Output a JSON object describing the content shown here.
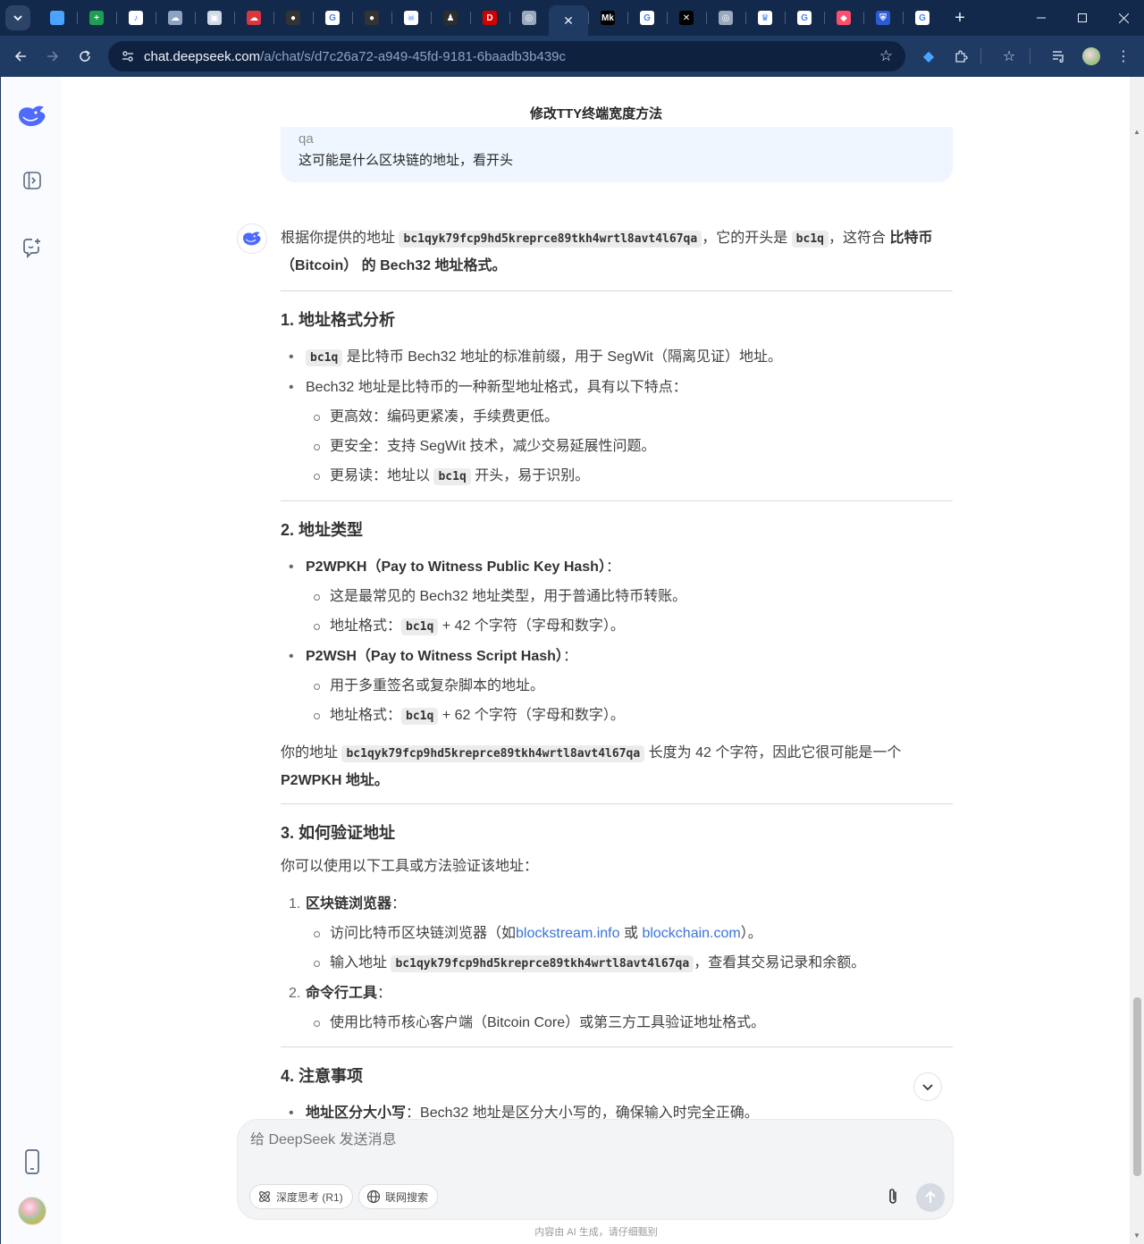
{
  "browser": {
    "tabs": [
      {
        "icon": "gem-icon",
        "color": "#4aa3ff",
        "text": ""
      },
      {
        "icon": "sheets-plus-icon",
        "color": "#1e9e52",
        "text": "+"
      },
      {
        "icon": "speaker-icon",
        "color": "#ffffff",
        "text": "♪"
      },
      {
        "icon": "cloud-icon",
        "color": "#8ea3c2",
        "text": "☁"
      },
      {
        "icon": "tv-icon",
        "color": "#cfd8e6",
        "text": "▣"
      },
      {
        "icon": "cloud-red-icon",
        "color": "#d9363e",
        "text": "☁"
      },
      {
        "icon": "github-icon",
        "color": "#333333",
        "text": "●"
      },
      {
        "icon": "google-icon",
        "color": "#ffffff",
        "text": "G"
      },
      {
        "icon": "github-icon",
        "color": "#333333",
        "text": "●"
      },
      {
        "icon": "skull-icon",
        "color": "#ffffff",
        "text": "☠"
      },
      {
        "icon": "figure-icon",
        "color": "#2d2d2d",
        "text": "♟"
      },
      {
        "icon": "d-letter-icon",
        "color": "#d40000",
        "text": "D"
      },
      {
        "icon": "chrome-icon",
        "color": "#9aa8bb",
        "text": "◎"
      },
      {
        "icon": "mk-icon",
        "color": "#000000",
        "text": "Mk"
      },
      {
        "icon": "google-icon",
        "color": "#ffffff",
        "text": "G"
      },
      {
        "icon": "x-grid-icon",
        "color": "#000000",
        "text": "✕"
      },
      {
        "icon": "chrome-icon",
        "color": "#9aa8bb",
        "text": "◎"
      },
      {
        "icon": "chef-hat-icon",
        "color": "#ffffff",
        "text": "♛"
      },
      {
        "icon": "google-icon",
        "color": "#ffffff",
        "text": "G"
      },
      {
        "icon": "cube-icon",
        "color": "#ff4d6d",
        "text": "◆"
      },
      {
        "icon": "shield-icon",
        "color": "#2d5bd3",
        "text": "⛨"
      },
      {
        "icon": "google-icon",
        "color": "#ffffff",
        "text": "G"
      }
    ],
    "active_tab_close": "✕",
    "new_tab": "+",
    "url_host": "chat.deepseek.com",
    "url_path": "/a/chat/s/d7c26a72-a949-45fd-9181-6baadb3b439c"
  },
  "chat": {
    "title": "修改TTY终端宽度方法",
    "user_prev_line": "qa",
    "user_message": "这可能是什么区块链的地址，看开头",
    "input_placeholder": "给 DeepSeek 发送消息",
    "deep_think_label": "深度思考 (R1)",
    "web_search_label": "联网搜索",
    "disclaimer": "内容由 AI 生成，请仔细甄别"
  },
  "answer": {
    "intro": {
      "p1": "根据你提供的地址",
      "addr": "bc1qyk79fcp9hd5kreprce89tkh4wrtl8avt4l67qa",
      "p2": "，它的开头是",
      "prefix": "bc1q",
      "p3": "，这符合",
      "bold": "比特币（Bitcoin） 的 Bech32 地址格式。"
    },
    "s1": {
      "title": "1. 地址格式分析",
      "b1_code": "bc1q",
      "b1_text": "是比特币 Bech32 地址的标准前缀，用于 SegWit（隔离见证）地址。",
      "b2_text": "Bech32 地址是比特币的一种新型地址格式，具有以下特点：",
      "sub1": "更高效：编码更紧凑，手续费更低。",
      "sub2": "更安全：支持 SegWit 技术，减少交易延展性问题。",
      "sub3_a": "更易读：地址以",
      "sub3_code": "bc1q",
      "sub3_b": "开头，易于识别。"
    },
    "s2": {
      "title": "2. 地址类型",
      "t1_bold": "P2WPKH（Pay to Witness Public Key Hash）",
      "t1_colon": "：",
      "t1_sub1": "这是最常见的 Bech32 地址类型，用于普通比特币转账。",
      "t1_sub2_a": "地址格式：",
      "t1_sub2_code": "bc1q",
      "t1_sub2_b": "+ 42 个字符（字母和数字）。",
      "t2_bold": "P2WSH（Pay to Witness Script Hash）",
      "t2_colon": "：",
      "t2_sub1": "用于多重签名或复杂脚本的地址。",
      "t2_sub2_a": "地址格式：",
      "t2_sub2_code": "bc1q",
      "t2_sub2_b": "+ 62 个字符（字母和数字）。",
      "concl_a": "你的地址",
      "concl_code": "bc1qyk79fcp9hd5kreprce89tkh4wrtl8avt4l67qa",
      "concl_b": "长度为 42 个字符，因此它很可能是一个",
      "concl_bold": "P2WPKH 地址。"
    },
    "s3": {
      "title": "3. 如何验证地址",
      "intro": "你可以使用以下工具或方法验证该地址：",
      "o1_num": "1.",
      "o1_bold": "区块链浏览器",
      "o1_colon": "：",
      "o1_sub1_a": "访问比特币区块链浏览器（如",
      "o1_link1": "blockstream.info",
      "o1_or": "或",
      "o1_link2": "blockchain.com",
      "o1_sub1_b": "）。",
      "o1_sub2_a": "输入地址",
      "o1_sub2_code": "bc1qyk79fcp9hd5kreprce89tkh4wrtl8avt4l67qa",
      "o1_sub2_b": "，查看其交易记录和余额。",
      "o2_num": "2.",
      "o2_bold": "命令行工具",
      "o2_colon": "：",
      "o2_sub1": "使用比特币核心客户端（Bitcoin Core）或第三方工具验证地址格式。"
    },
    "s4": {
      "title": "4. 注意事项",
      "b1_bold": "地址区分大小写",
      "b1_text": "：Bech32 地址是区分大小写的，确保输入时完全正确。"
    }
  },
  "colors": {
    "chrome_dark": "#13294b",
    "chrome_toolbar": "#1f3a63",
    "deepseek_blue": "#4d6bfe",
    "link": "#3b73d9",
    "user_bubble": "#eff6ff"
  }
}
